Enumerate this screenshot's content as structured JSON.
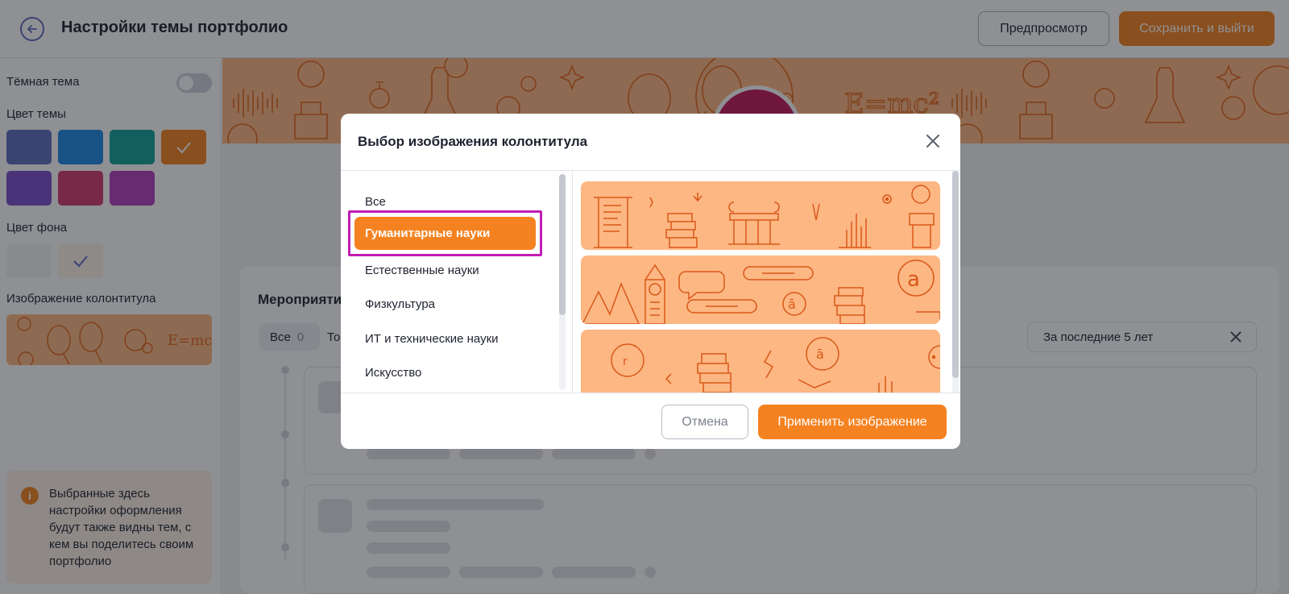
{
  "header": {
    "title": "Настройки темы портфолио",
    "preview_label": "Предпросмотр",
    "save_label": "Сохранить и выйти"
  },
  "sidebar": {
    "dark_theme_label": "Тёмная тема",
    "dark_theme_on": false,
    "theme_color_label": "Цвет темы",
    "theme_colors": [
      "#5c6bc0",
      "#1e88e5",
      "#0fa39a",
      "#f58220",
      "#7c4dcc",
      "#d13b6e",
      "#b03fbe"
    ],
    "theme_color_selected": "#f58220",
    "bg_color_label": "Цвет фона",
    "bg_colors": [
      "#f2f3f5",
      "#fdf3ea"
    ],
    "bg_color_selected": "#fdf3ea",
    "header_image_label": "Изображение колонтитула",
    "info_text": "Выбранные здесь настройки оформления будут также видны тем, с кем вы поделитесь своим портфолио"
  },
  "content": {
    "events_title": "Мероприяти",
    "filter_all_label": "Все",
    "filter_all_count": "0",
    "filter_next_label": "То",
    "period_value": "За последние 5 лет"
  },
  "modal": {
    "title": "Выбор изображения колонтитула",
    "categories": [
      "Все",
      "Гуманитарные науки",
      "Естественные науки",
      "Физкультура",
      "ИТ и технические науки",
      "Искусство"
    ],
    "selected_category": "Гуманитарные науки",
    "cancel_label": "Отмена",
    "apply_label": "Применить изображение"
  },
  "colors": {
    "accent": "#f58220",
    "highlight_frame": "#c21cb3",
    "pattern_bg": "#fdb782",
    "pattern_line": "#e2661a"
  },
  "icons": [
    "back-arrow-icon",
    "check-icon",
    "info-icon",
    "close-icon",
    "clear-icon"
  ]
}
